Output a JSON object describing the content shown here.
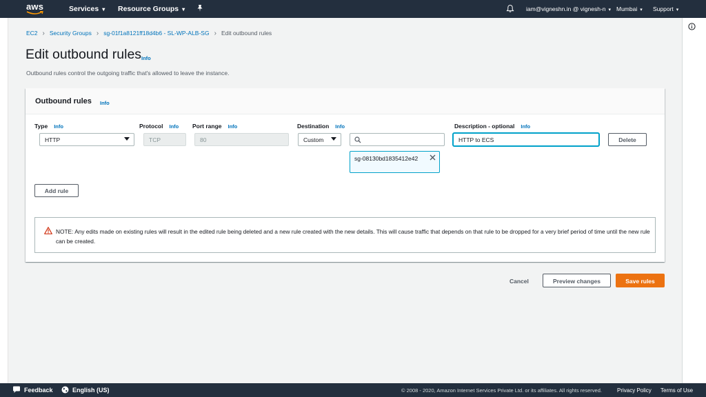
{
  "topnav": {
    "logo_text": "aws",
    "services": "Services",
    "resource_groups": "Resource Groups",
    "account": "iam@vigneshn.in @ vignesh-n",
    "region": "Mumbai",
    "support": "Support",
    "caret": "▾"
  },
  "breadcrumb": {
    "items": [
      "EC2",
      "Security Groups",
      "sg-01f1a8121ff18d4b6 - SL-WP-ALB-SG"
    ],
    "current": "Edit outbound rules",
    "separator": "›"
  },
  "page": {
    "title": "Edit outbound rules",
    "info": "Info",
    "description": "Outbound rules control the outgoing traffic that's allowed to leave the instance."
  },
  "panel": {
    "title": "Outbound rules",
    "info": "Info",
    "columns": {
      "type": "Type",
      "protocol": "Protocol",
      "port_range": "Port range",
      "destination": "Destination",
      "description": "Description - optional"
    },
    "rule": {
      "type": "HTTP",
      "protocol": "TCP",
      "port_range": "80",
      "destination_mode": "Custom",
      "destination_search": "",
      "destination_token": "sg-08130bd1835412e42",
      "description": "HTTP to ECS",
      "delete_label": "Delete"
    },
    "add_rule": "Add rule",
    "alert": "NOTE: Any edits made on existing rules will result in the edited rule being deleted and a new rule created with the new details. This will cause traffic that depends on that rule to be dropped for a very brief period of time until the new rule can be created."
  },
  "actions": {
    "cancel": "Cancel",
    "preview": "Preview changes",
    "save": "Save rules"
  },
  "footer": {
    "feedback": "Feedback",
    "language": "English (US)",
    "copyright": "© 2008 - 2020, Amazon Internet Services Private Ltd. or its affiliates. All rights reserved.",
    "privacy": "Privacy Policy",
    "terms": "Terms of Use"
  },
  "colors": {
    "nav_bg": "#232f3e",
    "link": "#0073bb",
    "primary": "#ec7211",
    "focus": "#00a1c9",
    "warning": "#d13212"
  },
  "icons": [
    "bell-icon",
    "pin-icon",
    "info-circle-icon",
    "search-icon",
    "close-icon",
    "warning-icon",
    "chat-bubble-icon",
    "globe-icon",
    "dropdown-arrow-icon"
  ]
}
